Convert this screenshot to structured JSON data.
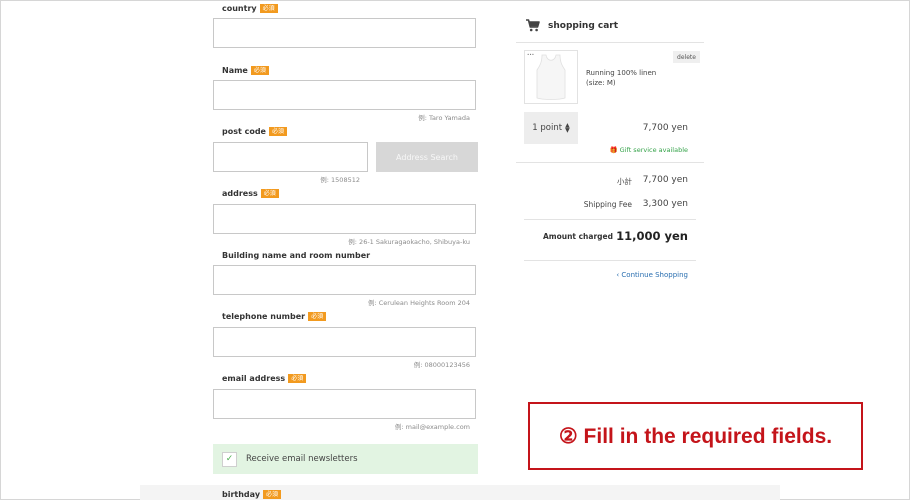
{
  "form": {
    "required_badge": "必須",
    "country": {
      "label": "country"
    },
    "name": {
      "label": "Name",
      "hint": "例: Taro Yamada"
    },
    "postcode": {
      "label": "post code",
      "hint": "例: 1508512",
      "button": "Address Search"
    },
    "address": {
      "label": "address",
      "hint": "例: 26-1 Sakuragaokacho, Shibuya-ku"
    },
    "building": {
      "label": "Building name and room number",
      "hint": "例: Cerulean Heights Room 204"
    },
    "telephone": {
      "label": "telephone number",
      "hint": "例: 08000123456"
    },
    "email": {
      "label": "email address",
      "hint": "例: mail@example.com"
    },
    "newsletter": {
      "label": "Receive email newsletters",
      "checked": true,
      "check_glyph": "✓"
    },
    "birthday": {
      "label": "birthday"
    }
  },
  "cart": {
    "title": "shopping cart",
    "item": {
      "name": "Running 100% linen (size: M)",
      "delete": "delete",
      "quantity": "1 point",
      "quantity_arrows": "▲▼",
      "price": "7,700 yen",
      "gift": "🎁 Gift service available"
    },
    "subtotal_label": "小計",
    "subtotal": "7,700 yen",
    "shipping_label": "Shipping Fee",
    "shipping": "3,300 yen",
    "total_label": "Amount charged",
    "total": "11,000 yen",
    "continue": "‹  Continue Shopping"
  },
  "callout": {
    "text": "② Fill in the required fields."
  },
  "colors": {
    "required": "#f29a1f",
    "callout": "#c4141a",
    "newsletter_bg": "#e2f4e2",
    "link": "#2a6fb0",
    "gift": "#35a34a"
  }
}
